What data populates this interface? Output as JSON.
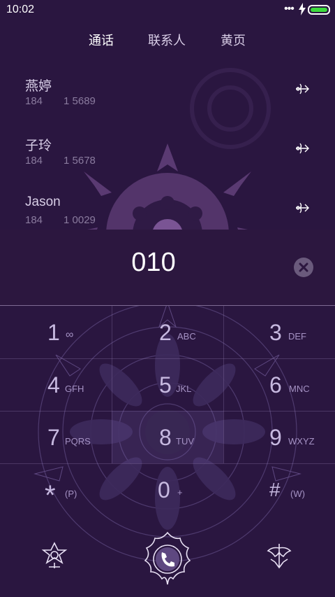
{
  "status": {
    "time": "10:02"
  },
  "tabs": [
    {
      "label": "通话",
      "active": true
    },
    {
      "label": "联系人",
      "active": false
    },
    {
      "label": "黄页",
      "active": false
    }
  ],
  "recent": [
    {
      "name": "燕婷",
      "num_prefix": "184",
      "num_suffix": "1 5689"
    },
    {
      "name": "子玲",
      "num_prefix": "184",
      "num_suffix": "1 5678"
    },
    {
      "name": "Jason",
      "num_prefix": "184",
      "num_suffix": "1 0029"
    }
  ],
  "dial": {
    "number": "010"
  },
  "keys": [
    {
      "digit": "1",
      "letters": "∞"
    },
    {
      "digit": "2",
      "letters": "ABC"
    },
    {
      "digit": "3",
      "letters": "DEF"
    },
    {
      "digit": "4",
      "letters": "GFH"
    },
    {
      "digit": "5",
      "letters": "JKL"
    },
    {
      "digit": "6",
      "letters": "MNC"
    },
    {
      "digit": "7",
      "letters": "PQRS"
    },
    {
      "digit": "8",
      "letters": "TUV"
    },
    {
      "digit": "9",
      "letters": "WXYZ"
    },
    {
      "digit": "*",
      "letters": "(P)"
    },
    {
      "digit": "0",
      "letters": "+"
    },
    {
      "digit": "#",
      "letters": "(W)"
    }
  ],
  "icons": {
    "detail": "ornament-arrow-icon",
    "clear": "clear-icon",
    "menu": "star-ornament-icon",
    "call": "phone-icon",
    "hide": "collapse-ornament-icon"
  },
  "colors": {
    "background": "#2a1640",
    "accent": "#c7b9e0",
    "battery": "#3ddb3d"
  }
}
